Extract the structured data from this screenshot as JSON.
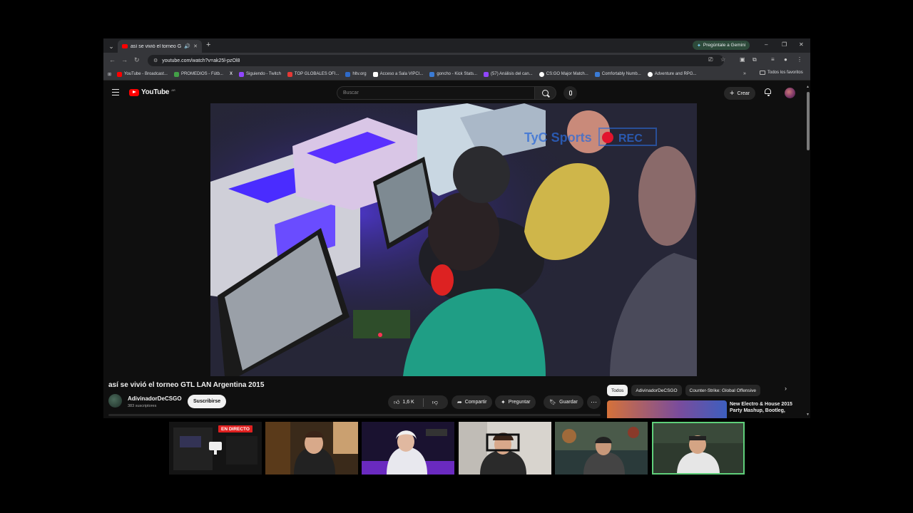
{
  "browser": {
    "tab_title": "así se vivió el torneo GTL LA",
    "tab_close": "✕",
    "new_tab": "+",
    "gemini_label": "Pregúntale a Gemini",
    "url": "youtube.com/watch?v=ak25l-pzOl8"
  },
  "bookmarks": [
    {
      "label": "YouTube - Broadcast...",
      "color": "#ff0000"
    },
    {
      "label": "PROMEDIOS - Fútb...",
      "color": "#43a047"
    },
    {
      "label": "X",
      "color": "#000000"
    },
    {
      "label": "Siguiendo - Twitch",
      "color": "#9146ff"
    },
    {
      "label": "TOP GLOBALES OFI...",
      "color": "#e53935"
    },
    {
      "label": "hltv.org",
      "color": "#2e6ac8"
    },
    {
      "label": "Acceso a Sala VIPCI...",
      "color": "#ffffff"
    },
    {
      "label": "goncho - Kick Stats...",
      "color": "#3a7bd5"
    },
    {
      "label": "(57) Análisis del can...",
      "color": "#9146ff"
    },
    {
      "label": "CS:GO Major Match...",
      "color": "#ffffff"
    },
    {
      "label": "Comfortably Numb...",
      "color": "#3a7bd5"
    },
    {
      "label": "Adventure and RPG...",
      "color": "#ffffff"
    }
  ],
  "bookmarks_more": "»",
  "bookmarks_all": "Todos los favoritos",
  "youtube": {
    "logo_text": "YouTube",
    "logo_country": "AR",
    "search_placeholder": "Buscar",
    "create_label": "Crear"
  },
  "video": {
    "title": "así se vivió el torneo GTL LAN Argentina 2015",
    "channel_name": "AdivinadorDeCSGO",
    "subscribers": "383 suscriptores",
    "subscribe_label": "Suscribirse",
    "likes": "1,6 K",
    "share_label": "Compartir",
    "ask_label": "Preguntar",
    "save_label": "Guardar",
    "overlay_text": "TyC Sports",
    "overlay_rec": "REC"
  },
  "chips": [
    "Todos",
    "AdivinadorDeCSGO",
    "Counter-Strike: Global Offensive"
  ],
  "recommended": {
    "title": "New Electro & House 2015 Party Mashup, Bootleg,"
  },
  "cams": {
    "live_label": "EN DIRECTO"
  }
}
